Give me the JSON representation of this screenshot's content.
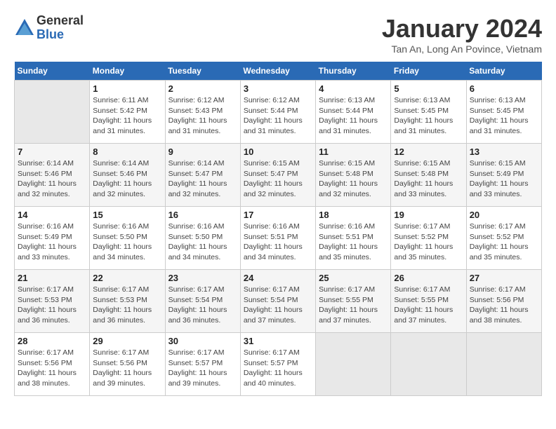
{
  "header": {
    "logo_general": "General",
    "logo_blue": "Blue",
    "month_title": "January 2024",
    "location": "Tan An, Long An Povince, Vietnam"
  },
  "days_of_week": [
    "Sunday",
    "Monday",
    "Tuesday",
    "Wednesday",
    "Thursday",
    "Friday",
    "Saturday"
  ],
  "weeks": [
    [
      {
        "day": "",
        "info": ""
      },
      {
        "day": "1",
        "info": "Sunrise: 6:11 AM\nSunset: 5:42 PM\nDaylight: 11 hours\nand 31 minutes."
      },
      {
        "day": "2",
        "info": "Sunrise: 6:12 AM\nSunset: 5:43 PM\nDaylight: 11 hours\nand 31 minutes."
      },
      {
        "day": "3",
        "info": "Sunrise: 6:12 AM\nSunset: 5:44 PM\nDaylight: 11 hours\nand 31 minutes."
      },
      {
        "day": "4",
        "info": "Sunrise: 6:13 AM\nSunset: 5:44 PM\nDaylight: 11 hours\nand 31 minutes."
      },
      {
        "day": "5",
        "info": "Sunrise: 6:13 AM\nSunset: 5:45 PM\nDaylight: 11 hours\nand 31 minutes."
      },
      {
        "day": "6",
        "info": "Sunrise: 6:13 AM\nSunset: 5:45 PM\nDaylight: 11 hours\nand 31 minutes."
      }
    ],
    [
      {
        "day": "7",
        "info": "Sunrise: 6:14 AM\nSunset: 5:46 PM\nDaylight: 11 hours\nand 32 minutes."
      },
      {
        "day": "8",
        "info": "Sunrise: 6:14 AM\nSunset: 5:46 PM\nDaylight: 11 hours\nand 32 minutes."
      },
      {
        "day": "9",
        "info": "Sunrise: 6:14 AM\nSunset: 5:47 PM\nDaylight: 11 hours\nand 32 minutes."
      },
      {
        "day": "10",
        "info": "Sunrise: 6:15 AM\nSunset: 5:47 PM\nDaylight: 11 hours\nand 32 minutes."
      },
      {
        "day": "11",
        "info": "Sunrise: 6:15 AM\nSunset: 5:48 PM\nDaylight: 11 hours\nand 32 minutes."
      },
      {
        "day": "12",
        "info": "Sunrise: 6:15 AM\nSunset: 5:48 PM\nDaylight: 11 hours\nand 33 minutes."
      },
      {
        "day": "13",
        "info": "Sunrise: 6:15 AM\nSunset: 5:49 PM\nDaylight: 11 hours\nand 33 minutes."
      }
    ],
    [
      {
        "day": "14",
        "info": "Sunrise: 6:16 AM\nSunset: 5:49 PM\nDaylight: 11 hours\nand 33 minutes."
      },
      {
        "day": "15",
        "info": "Sunrise: 6:16 AM\nSunset: 5:50 PM\nDaylight: 11 hours\nand 34 minutes."
      },
      {
        "day": "16",
        "info": "Sunrise: 6:16 AM\nSunset: 5:50 PM\nDaylight: 11 hours\nand 34 minutes."
      },
      {
        "day": "17",
        "info": "Sunrise: 6:16 AM\nSunset: 5:51 PM\nDaylight: 11 hours\nand 34 minutes."
      },
      {
        "day": "18",
        "info": "Sunrise: 6:16 AM\nSunset: 5:51 PM\nDaylight: 11 hours\nand 35 minutes."
      },
      {
        "day": "19",
        "info": "Sunrise: 6:17 AM\nSunset: 5:52 PM\nDaylight: 11 hours\nand 35 minutes."
      },
      {
        "day": "20",
        "info": "Sunrise: 6:17 AM\nSunset: 5:52 PM\nDaylight: 11 hours\nand 35 minutes."
      }
    ],
    [
      {
        "day": "21",
        "info": "Sunrise: 6:17 AM\nSunset: 5:53 PM\nDaylight: 11 hours\nand 36 minutes."
      },
      {
        "day": "22",
        "info": "Sunrise: 6:17 AM\nSunset: 5:53 PM\nDaylight: 11 hours\nand 36 minutes."
      },
      {
        "day": "23",
        "info": "Sunrise: 6:17 AM\nSunset: 5:54 PM\nDaylight: 11 hours\nand 36 minutes."
      },
      {
        "day": "24",
        "info": "Sunrise: 6:17 AM\nSunset: 5:54 PM\nDaylight: 11 hours\nand 37 minutes."
      },
      {
        "day": "25",
        "info": "Sunrise: 6:17 AM\nSunset: 5:55 PM\nDaylight: 11 hours\nand 37 minutes."
      },
      {
        "day": "26",
        "info": "Sunrise: 6:17 AM\nSunset: 5:55 PM\nDaylight: 11 hours\nand 37 minutes."
      },
      {
        "day": "27",
        "info": "Sunrise: 6:17 AM\nSunset: 5:56 PM\nDaylight: 11 hours\nand 38 minutes."
      }
    ],
    [
      {
        "day": "28",
        "info": "Sunrise: 6:17 AM\nSunset: 5:56 PM\nDaylight: 11 hours\nand 38 minutes."
      },
      {
        "day": "29",
        "info": "Sunrise: 6:17 AM\nSunset: 5:56 PM\nDaylight: 11 hours\nand 39 minutes."
      },
      {
        "day": "30",
        "info": "Sunrise: 6:17 AM\nSunset: 5:57 PM\nDaylight: 11 hours\nand 39 minutes."
      },
      {
        "day": "31",
        "info": "Sunrise: 6:17 AM\nSunset: 5:57 PM\nDaylight: 11 hours\nand 40 minutes."
      },
      {
        "day": "",
        "info": ""
      },
      {
        "day": "",
        "info": ""
      },
      {
        "day": "",
        "info": ""
      }
    ]
  ]
}
